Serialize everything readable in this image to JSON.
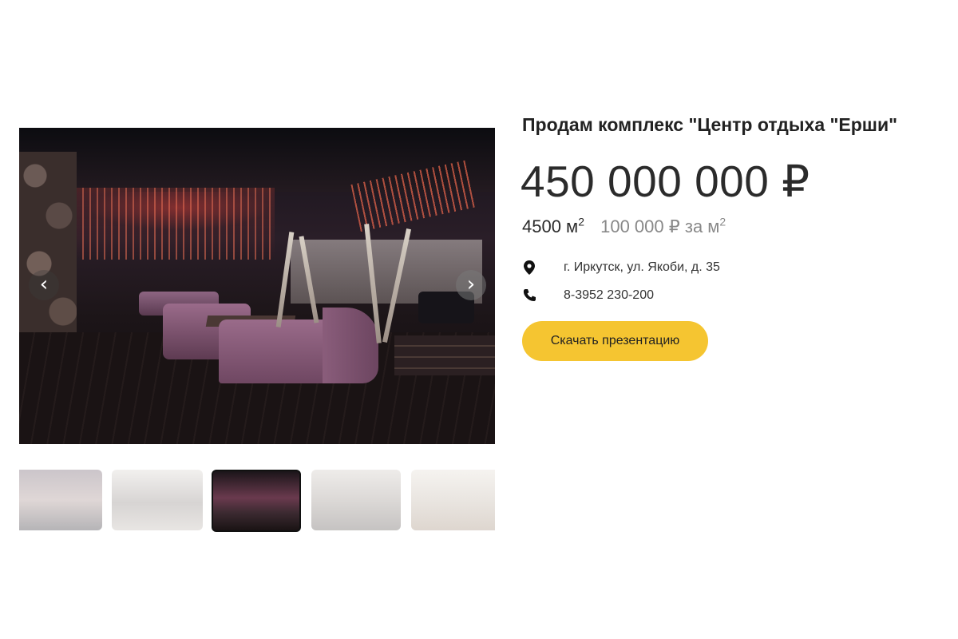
{
  "gallery": {
    "main_image": "venue-interior-photo",
    "prev_icon": "chevron-left-icon",
    "next_icon": "chevron-right-icon",
    "prev_glyph": "‹",
    "next_glyph": "›",
    "thumbnails": [
      {
        "name": "bar-counter-photo",
        "active": false
      },
      {
        "name": "hall-photo",
        "active": false
      },
      {
        "name": "venue-interior-photo",
        "active": true
      },
      {
        "name": "lounge-photo",
        "active": false
      },
      {
        "name": "banquet-hall-photo",
        "active": false
      }
    ]
  },
  "listing": {
    "title": "Продам комплекс \"Центр отдыха \"Ерши\"",
    "price": "450 000 000 ₽",
    "area_value": "4500 м",
    "area_sup": "2",
    "price_per_sqm": "100 000  ₽ за м",
    "price_per_sqm_sup": "2",
    "address": "г. Иркутск, ул. Якоби, д. 35",
    "phone": "8-3952 230-200",
    "download_label": "Скачать презентацию"
  },
  "colors": {
    "button_bg": "#f5c531",
    "text": "#222222",
    "muted": "#888888"
  }
}
